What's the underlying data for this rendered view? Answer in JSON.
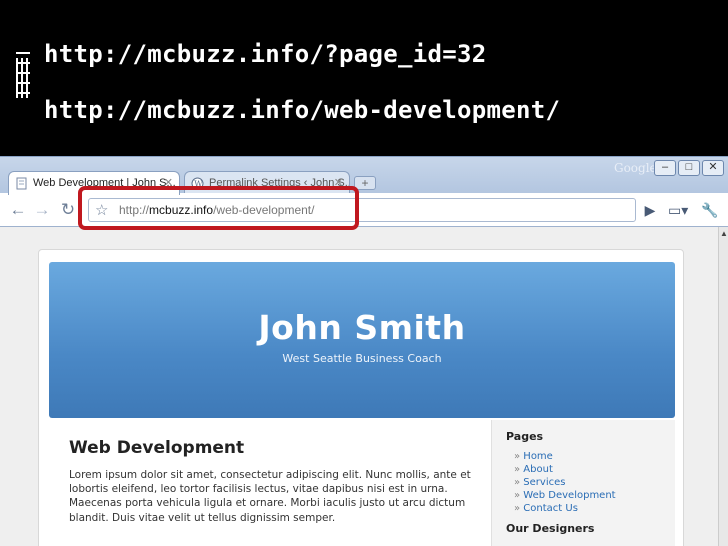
{
  "slide": {
    "url_lines": [
      "http://mcbuzz.info/?page_id=32",
      "http://mcbuzz.info/web-development/"
    ]
  },
  "browser": {
    "tabs": [
      {
        "label": "Web Development | John S...",
        "active": true
      },
      {
        "label": "Permalink Settings ‹ John S...",
        "active": false
      }
    ],
    "brand": "Google",
    "window_controls": [
      "–",
      "□",
      "✕"
    ],
    "address": {
      "prefix": "http://",
      "domain": "mcbuzz.info",
      "path": "/web-development/"
    },
    "icons": {
      "back": "back-arrow-icon",
      "forward": "forward-arrow-icon",
      "reload": "reload-icon",
      "star": "bookmark-star-icon",
      "go": "go-arrow-icon",
      "page_menu": "page-menu-icon",
      "wrench": "wrench-icon"
    },
    "highlight_color": "#c0181f"
  },
  "site": {
    "title": "John Smith",
    "subtitle": "West Seattle Business Coach",
    "post": {
      "title": "Web Development",
      "body": "Lorem ipsum dolor sit amet, consectetur adipiscing elit. Nunc mollis, ante et lobortis eleifend, leo tortor facilisis lectus, vitae dapibus nisi est in urna. Maecenas porta vehicula ligula et ornare. Morbi iaculis justo ut arcu dictum blandit. Duis vitae velit ut tellus dignissim semper."
    },
    "sidebar": {
      "pages_heading": "Pages",
      "pages": [
        "Home",
        "About",
        "Services",
        "Web Development",
        "Contact Us"
      ],
      "designers_heading": "Our Designers"
    }
  }
}
